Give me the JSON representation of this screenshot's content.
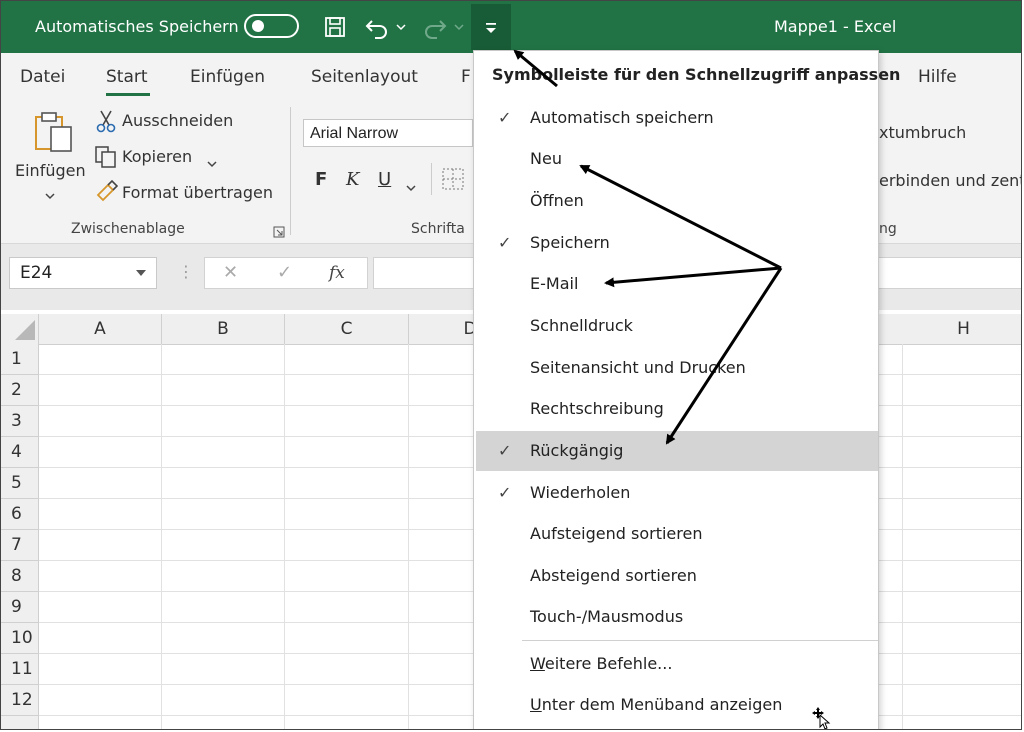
{
  "titlebar": {
    "autosave_label": "Automatisches Speichern",
    "doc_title": "Mappe1  -  Excel"
  },
  "tabs": [
    "Datei",
    "Start",
    "Einfügen",
    "Seitenlayout",
    "F",
    "Hilfe"
  ],
  "ribbon": {
    "paste_label": "Einfügen",
    "cut_label": "Ausschneiden",
    "copy_label": "Kopieren",
    "format_painter_label": "Format übertragen",
    "clipboard_group": "Zwischenablage",
    "font_name": "Arial Narrow",
    "font_group": "Schrifta",
    "bold": "F",
    "italic": "K",
    "underline": "U",
    "wrap_text": "xtumbruch",
    "merge_center": "erbinden und zentr",
    "alignment_group": "ng"
  },
  "formula": {
    "namebox": "E24",
    "fx": "fx",
    "cancel": "✕",
    "enter": "✓"
  },
  "columns": [
    "A",
    "B",
    "C",
    "D",
    "H"
  ],
  "rows": [
    "1",
    "2",
    "3",
    "4",
    "5",
    "6",
    "7",
    "8",
    "9",
    "10",
    "11",
    "12"
  ],
  "menu": {
    "title": "Symbolleiste für den Schnellzugriff anpassen",
    "items": [
      {
        "label": "Automatisch speichern",
        "checked": "✓"
      },
      {
        "label": "Neu",
        "checked": ""
      },
      {
        "label": "Öffnen",
        "checked": ""
      },
      {
        "label": "Speichern",
        "checked": "✓"
      },
      {
        "label": "E-Mail",
        "checked": ""
      },
      {
        "label": "Schnelldruck",
        "checked": ""
      },
      {
        "label": "Seitenansicht und Drucken",
        "checked": ""
      },
      {
        "label": "Rechtschreibung",
        "checked": ""
      },
      {
        "label": "Rückgängig",
        "checked": "✓"
      },
      {
        "label": "Wiederholen",
        "checked": "✓"
      },
      {
        "label": "Aufsteigend sortieren",
        "checked": ""
      },
      {
        "label": "Absteigend sortieren",
        "checked": ""
      },
      {
        "label": "Touch-/Mausmodus",
        "checked": ""
      }
    ],
    "more_commands": "Weitere Befehle...",
    "show_below": "Unter dem Menüband anzeigen"
  },
  "colors": {
    "excel_green": "#217346",
    "highlight": "#d4d4d4"
  }
}
